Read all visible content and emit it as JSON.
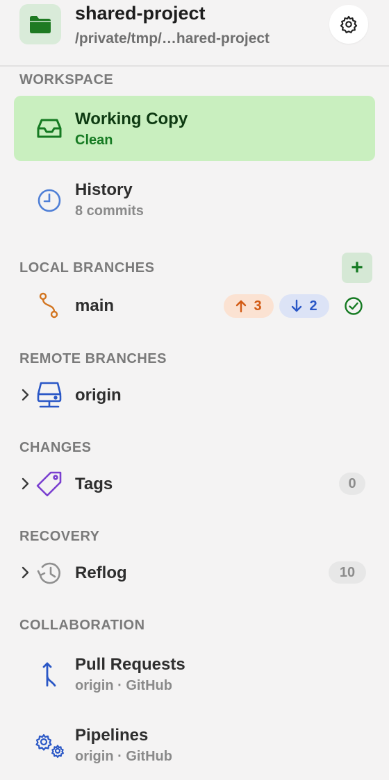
{
  "header": {
    "title": "shared-project",
    "path": "/private/tmp/…hared-project",
    "folder_icon": "folder-icon",
    "settings_icon": "gear-icon"
  },
  "sections": {
    "workspace": "WORKSPACE",
    "local_branches": "LOCAL BRANCHES",
    "remote_branches": "REMOTE BRANCHES",
    "changes": "CHANGES",
    "recovery": "RECOVERY",
    "collaboration": "COLLABORATION"
  },
  "workspace": {
    "working_copy": {
      "title": "Working Copy",
      "status": "Clean"
    },
    "history": {
      "title": "History",
      "count": "8 commits"
    }
  },
  "local_branches": {
    "add_label": "+",
    "main": {
      "name": "main",
      "ahead": "3",
      "behind": "2"
    }
  },
  "remote_branches": {
    "origin": "origin"
  },
  "changes": {
    "tags": {
      "label": "Tags",
      "count": "0"
    }
  },
  "recovery": {
    "reflog": {
      "label": "Reflog",
      "count": "10"
    }
  },
  "collaboration": {
    "pull_requests": {
      "title": "Pull Requests",
      "sub": "origin · GitHub"
    },
    "pipelines": {
      "title": "Pipelines",
      "sub": "origin · GitHub"
    }
  },
  "colors": {
    "selected_bg": "#c9efbf",
    "accent_green": "#157a22",
    "ahead_orange": "#d25a13",
    "behind_blue": "#2a57c6",
    "tag_purple": "#7a3fd0"
  }
}
